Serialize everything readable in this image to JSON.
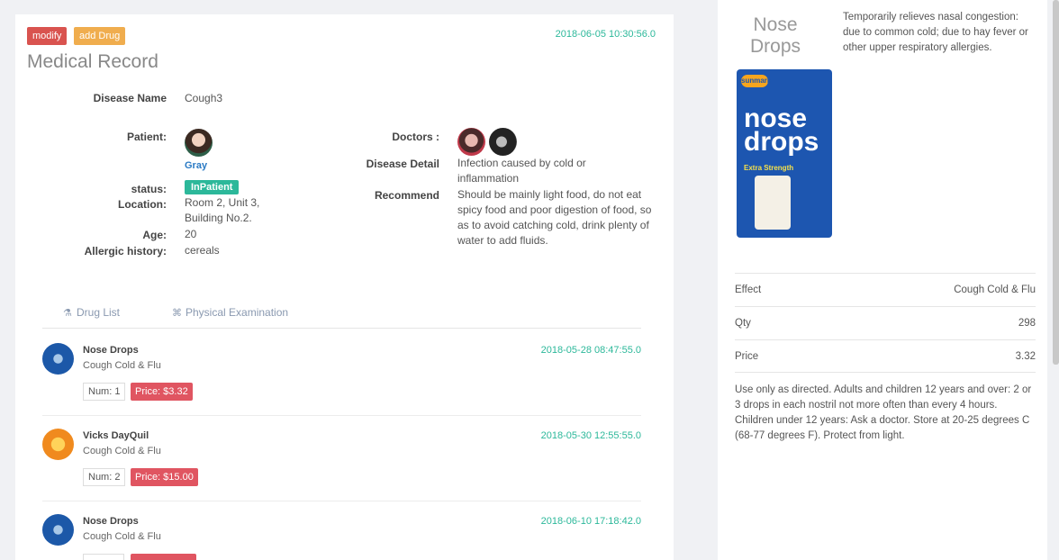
{
  "record": {
    "modify_label": "modify",
    "add_drug_label": "add Drug",
    "timestamp": "2018-06-05 10:30:56.0",
    "title": "Medical Record",
    "disease_name_label": "Disease Name",
    "disease_name": "Cough3",
    "patient_label": "Patient:",
    "patient_name": "Gray",
    "status_label": "status:",
    "status": "InPatient",
    "location_label": "Location:",
    "location": "Room 2, Unit 3, Building No.2.",
    "age_label": "Age:",
    "age": "20",
    "allergic_label": "Allergic history:",
    "allergic": "cereals",
    "doctors_label": "Doctors :",
    "disease_detail_label": "Disease Detail",
    "disease_detail": "Infection caused by cold or inflammation",
    "recommend_label": "Recommend",
    "recommend": "Should be mainly light food, do not eat spicy food and poor digestion of food, so as to avoid catching cold, drink plenty of water to add fluids."
  },
  "tabs": [
    {
      "label": "Drug List",
      "icon": "flask-icon"
    },
    {
      "label": "Physical Examination",
      "icon": "binoculars-icon"
    }
  ],
  "drugs": [
    {
      "name": "Nose Drops",
      "effect": "Cough Cold & Flu",
      "time": "2018-05-28 08:47:55.0",
      "num": "Num: 1",
      "price": "Price: $3.32",
      "thumb": "nose"
    },
    {
      "name": "Vicks DayQuil",
      "effect": "Cough Cold & Flu",
      "time": "2018-05-30 12:55:55.0",
      "num": "Num: 2",
      "price": "Price: $15.00",
      "thumb": "vicks"
    },
    {
      "name": "Nose Drops",
      "effect": "Cough Cold & Flu",
      "time": "2018-06-10 17:18:42.0",
      "num": "",
      "price": "",
      "thumb": "nose"
    }
  ],
  "detail": {
    "title": "Nose Drops",
    "description": "Temporarily relieves nasal congestion: due to common cold; due to hay fever or other upper respiratory allergies.",
    "box_brand": "sunmark",
    "box_text": "nose drops",
    "box_sub": "Extra Strength",
    "rows": [
      {
        "key": "Effect",
        "value": "Cough Cold & Flu"
      },
      {
        "key": "Qty",
        "value": "298"
      },
      {
        "key": "Price",
        "value": "3.32"
      }
    ],
    "note": "Use only as directed. Adults and children 12 years and over: 2 or 3 drops in each nostril not more often than every 4 hours. Children under 12 years: Ask a doctor. Store at 20-25 degrees C (68-77 degrees F). Protect from light."
  }
}
